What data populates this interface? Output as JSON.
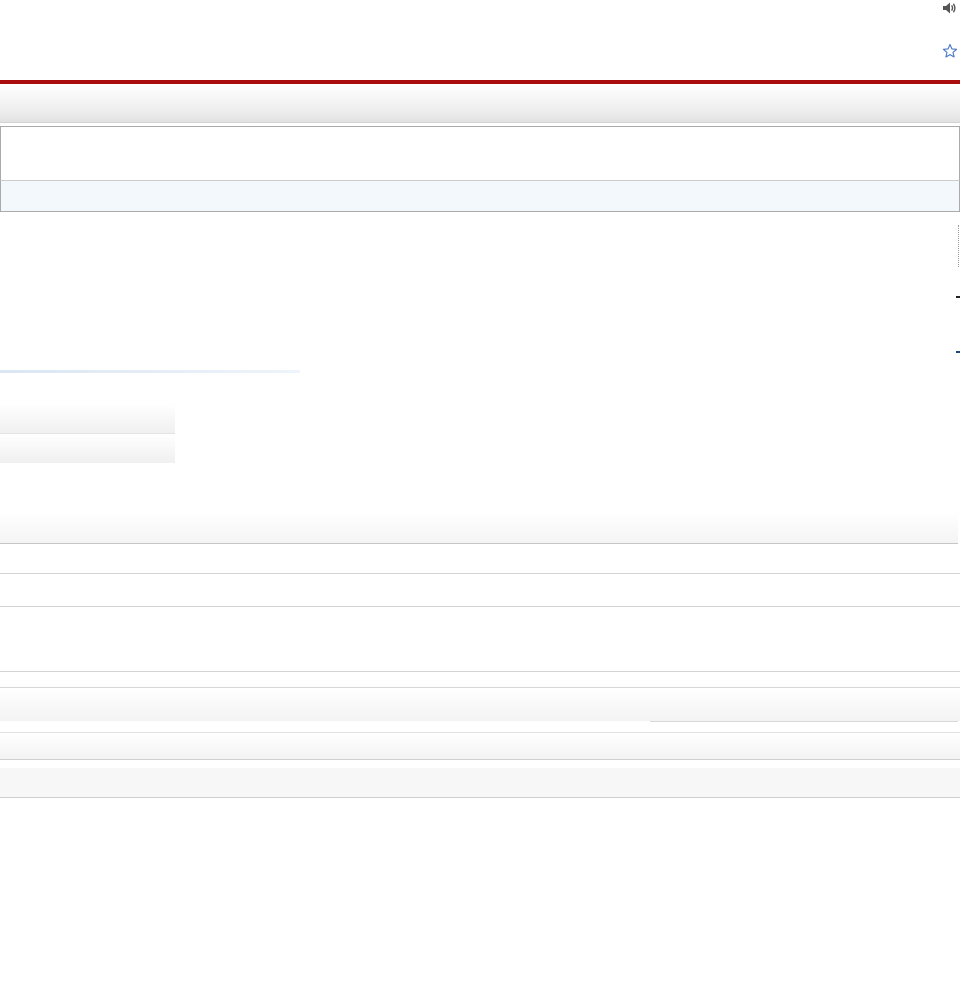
{
  "header": {
    "speaker_icon": "speaker-icon",
    "favorite_icon": "star-icon"
  },
  "colors": {
    "accent_rule": "#a90d0d",
    "search_bar_bg": "#f3f8fd",
    "star_icon": "#4a78c2"
  }
}
